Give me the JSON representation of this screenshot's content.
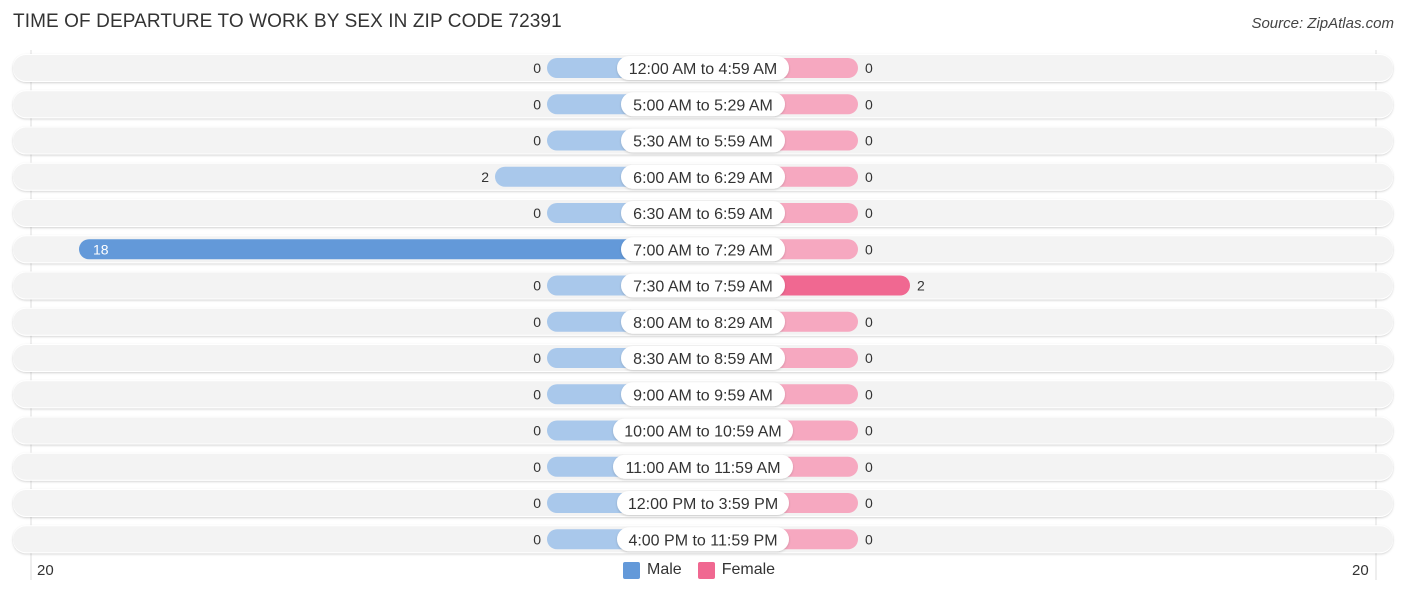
{
  "title": "TIME OF DEPARTURE TO WORK BY SEX IN ZIP CODE 72391",
  "source": "Source: ZipAtlas.com",
  "colors": {
    "male": "#a9c8eb",
    "male_strong": "#6399d9",
    "female": "#f6a8c0",
    "female_strong": "#f06891",
    "row_bg": "#f3f3f3",
    "label_bg": "#ffffff"
  },
  "chart_data": {
    "type": "bar",
    "orientation": "horizontal-diverging",
    "title": "TIME OF DEPARTURE TO WORK BY SEX IN ZIP CODE 72391",
    "categories": [
      "12:00 AM to 4:59 AM",
      "5:00 AM to 5:29 AM",
      "5:30 AM to 5:59 AM",
      "6:00 AM to 6:29 AM",
      "6:30 AM to 6:59 AM",
      "7:00 AM to 7:29 AM",
      "7:30 AM to 7:59 AM",
      "8:00 AM to 8:29 AM",
      "8:30 AM to 8:59 AM",
      "9:00 AM to 9:59 AM",
      "10:00 AM to 10:59 AM",
      "11:00 AM to 11:59 AM",
      "12:00 PM to 3:59 PM",
      "4:00 PM to 11:59 PM"
    ],
    "series": [
      {
        "name": "Male",
        "values": [
          0,
          0,
          0,
          2,
          0,
          18,
          0,
          0,
          0,
          0,
          0,
          0,
          0,
          0
        ]
      },
      {
        "name": "Female",
        "values": [
          0,
          0,
          0,
          0,
          0,
          0,
          2,
          0,
          0,
          0,
          0,
          0,
          0,
          0
        ]
      }
    ],
    "xlim": [
      -20,
      20
    ],
    "axis_tick_labels": {
      "left": "20",
      "right": "20"
    },
    "legend": {
      "position": "bottom-center",
      "entries": [
        "Male",
        "Female"
      ]
    },
    "grid": false
  },
  "legend": {
    "male": "Male",
    "female": "Female"
  },
  "axis": {
    "left": "20",
    "right": "20"
  }
}
